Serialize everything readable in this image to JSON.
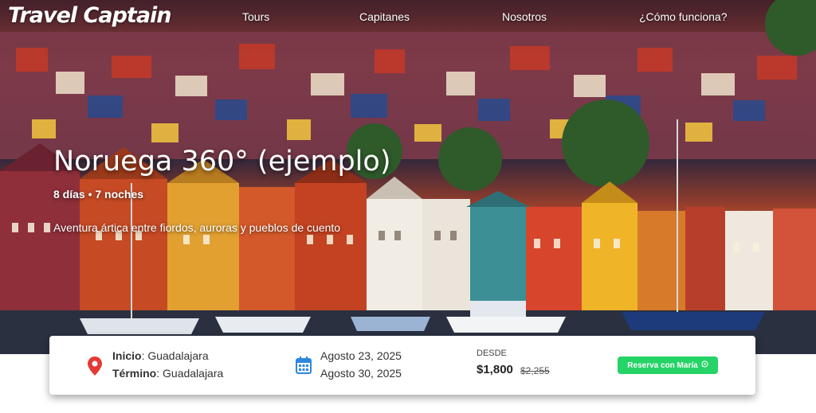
{
  "brand": {
    "logo_text": "Travel Captain"
  },
  "nav": {
    "items": [
      {
        "label": "Tours"
      },
      {
        "label": "Capitanes"
      },
      {
        "label": "Nosotros"
      },
      {
        "label": "¿Cómo funciona?"
      }
    ]
  },
  "hero": {
    "title": "Noruega 360° (ejemplo)",
    "duration": "8 días • 7 noches",
    "subtitle": "Aventura ártica entre fiordos, auroras y pueblos de cuento"
  },
  "trip": {
    "start_label": "Inicio",
    "start_value": "Guadalajara",
    "end_label": "Término",
    "end_value": "Guadalajara",
    "date_start": "Agosto 23, 2025",
    "date_end": "Agosto 30, 2025",
    "price_label": "DESDE",
    "price_now": "$1,800",
    "price_old": "$2,255",
    "cta_label": "Reserva con María"
  },
  "colors": {
    "cta": "#25d366",
    "location_icon": "#e53935",
    "calendar_icon": "#2e86de"
  },
  "icons": [
    "location-pin-icon",
    "calendar-icon",
    "whatsapp-icon"
  ]
}
